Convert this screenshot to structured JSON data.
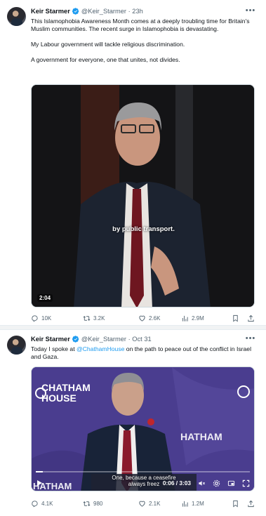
{
  "tweets": [
    {
      "author": "Keir Starmer",
      "handle": "@Keir_Starmer",
      "time": "23h",
      "paragraphs": [
        "This Islamophobia Awareness Month comes at a deeply troubling time for Britain's Muslim communities. The recent surge in Islamophobia is devastating.",
        "My Labour government will tackle religious discrimination.",
        "A government for everyone, one that unites, not divides."
      ],
      "video": {
        "caption": "by public transport.",
        "duration": "2:04"
      },
      "stats": {
        "replies": "10K",
        "reposts": "3.2K",
        "likes": "2.6K",
        "views": "2.9M"
      }
    },
    {
      "author": "Keir Starmer",
      "handle": "@Keir_Starmer",
      "time": "Oct 31",
      "text_before": "Today I spoke at ",
      "mention": "@ChathamHouse",
      "text_after": " on the path to peace out of the conflict in Israel and Gaza.",
      "video": {
        "brand_line1": "CHATHAM",
        "brand_line2": "HOUSE",
        "backdrop_brand": "HATHAM",
        "bottom_brand": "HATHAM",
        "subtitle_line1": "One, because a ceasefire",
        "subtitle_line2": "always freez",
        "time": "0:06 / 3:03",
        "progress": 0.033
      },
      "stats": {
        "replies": "4.1K",
        "reposts": "980",
        "likes": "2.1K",
        "views": "1.2M"
      }
    }
  ],
  "icons": {
    "verified": "verified-badge-icon",
    "more": "more-options-icon",
    "reply": "reply-icon",
    "repost": "repost-icon",
    "like": "like-icon",
    "views": "views-icon",
    "bookmark": "bookmark-icon",
    "share": "share-icon"
  },
  "colors": {
    "accent": "#1d9bf0",
    "chatham_bg": "#4a3d8f",
    "secondary_text": "#536471"
  }
}
